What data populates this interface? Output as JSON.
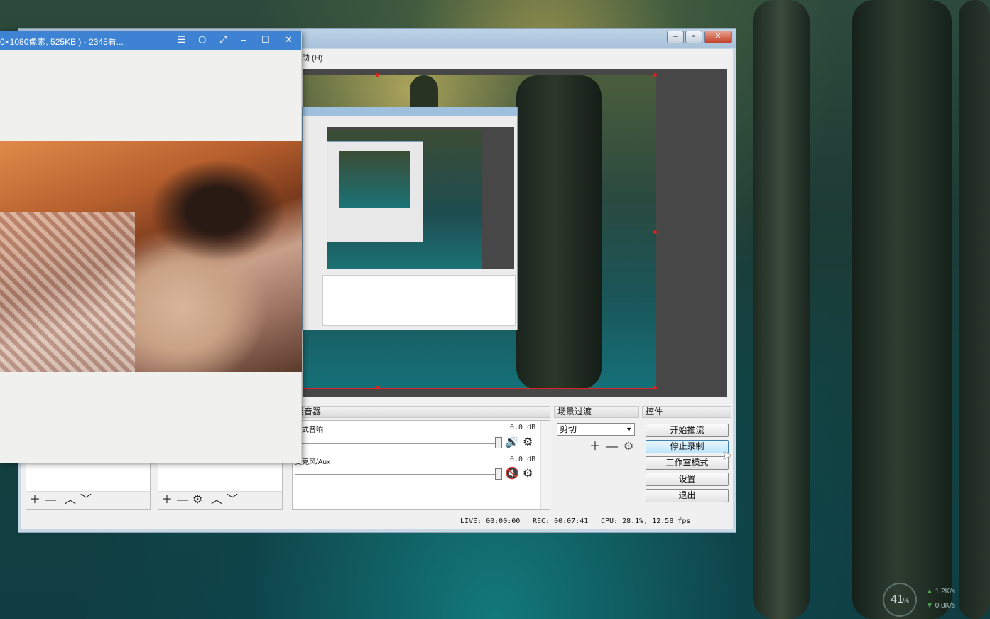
{
  "viewer": {
    "title": "0×1080像素, 525KB ) - 2345看...",
    "buttons": {
      "menu": "☰",
      "skin": "⬡",
      "fullscreen": "⤢",
      "minimize": "–",
      "maximize": "☐",
      "close": "✕"
    }
  },
  "obs": {
    "menu_partial": "助 (H)",
    "mixer": {
      "header": "混音器",
      "tracks": [
        {
          "label": "台式音响",
          "level": "0.0 dB",
          "muted": false
        },
        {
          "label": "麦克风/Aux",
          "level": "0.0 dB",
          "muted": true
        }
      ]
    },
    "transition": {
      "header": "场景过渡",
      "selected": "剪切"
    },
    "controls": {
      "header": "控件",
      "start_stream": "开始推流",
      "stop_record": "停止录制",
      "studio_mode": "工作室模式",
      "settings": "设置",
      "exit": "退出"
    },
    "status": {
      "live": "LIVE: 00:00:00",
      "rec": "REC: 00:07:41",
      "cpu": "CPU: 28.1%, 12.58 fps"
    }
  },
  "desktop": {
    "perf_percent": "41",
    "perf_unit": "%",
    "upload": "1.2K/s",
    "download": "0.8K/s"
  },
  "colors": {
    "viewer_titlebar": "#3e83d3",
    "preview_border": "#dd2222",
    "obs_background": "#f0f0f0"
  }
}
